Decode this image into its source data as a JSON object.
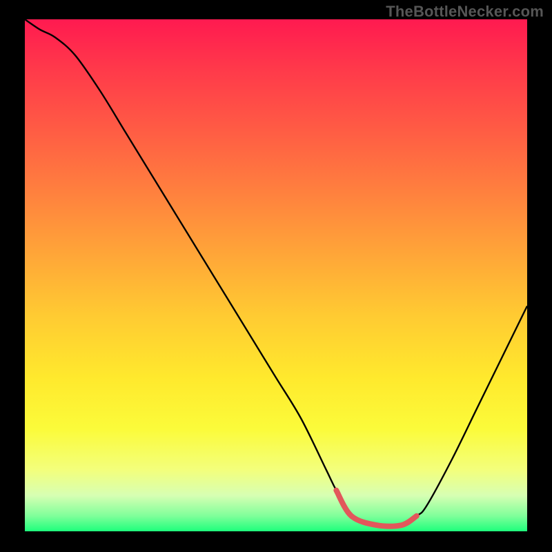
{
  "watermark": "TheBottleNecker.com",
  "chart_data": {
    "type": "line",
    "title": "",
    "xlabel": "",
    "ylabel": "",
    "xlim": [
      0,
      100
    ],
    "ylim": [
      0,
      100
    ],
    "x": [
      0,
      3,
      6,
      10,
      15,
      20,
      25,
      30,
      35,
      40,
      45,
      50,
      55,
      60,
      62,
      65,
      70,
      75,
      78,
      80,
      85,
      90,
      95,
      100
    ],
    "values": [
      100,
      98,
      96.5,
      93,
      86,
      78,
      70,
      62,
      54,
      46,
      38,
      30,
      22,
      12,
      8,
      3,
      1.2,
      1.2,
      3,
      5,
      14,
      24,
      34,
      44
    ],
    "optimal_range_x": [
      62,
      78
    ],
    "annotations": []
  },
  "colors": {
    "curve": "#000000",
    "optimal_segment": "#e2575b",
    "gradient_top": "#ff1a50",
    "gradient_bottom": "#1eff7c",
    "watermark": "#565656",
    "frame_bg": "#000000"
  }
}
